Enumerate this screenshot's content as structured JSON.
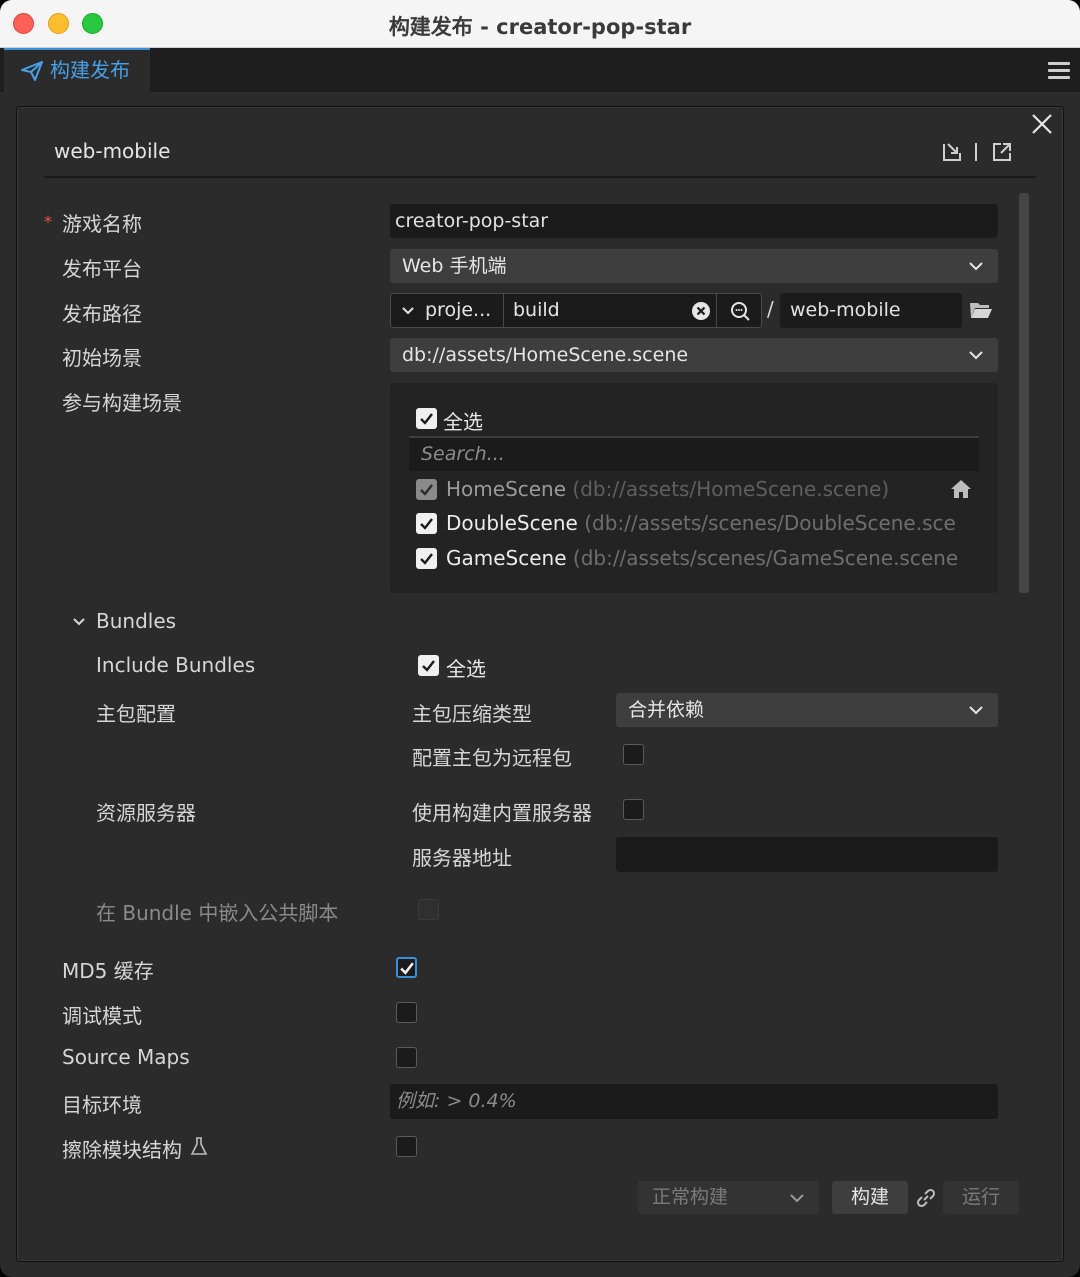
{
  "window": {
    "title": "构建发布 - creator-pop-star"
  },
  "tab": {
    "label": "构建发布"
  },
  "panel": {
    "platform_id": "web-mobile"
  },
  "form": {
    "game_name_label": "游戏名称",
    "game_name_required": "*",
    "game_name_value": "creator-pop-star",
    "platform_label": "发布平台",
    "platform_value": "Web 手机端",
    "path_label": "发布路径",
    "path_project": "proje...",
    "path_dir": "build",
    "path_separator": "/",
    "path_subdir": "web-mobile",
    "start_scene_label": "初始场景",
    "start_scene_value": "db://assets/HomeScene.scene",
    "scenes_label": "参与构建场景",
    "scenes_select_all": "全选",
    "scenes_search_placeholder": "Search...",
    "scenes": [
      {
        "name": "HomeScene",
        "path": "(db://assets/HomeScene.scene)",
        "checked": true,
        "locked": true
      },
      {
        "name": "DoubleScene",
        "path": "(db://assets/scenes/DoubleScene.sce",
        "checked": true,
        "locked": false
      },
      {
        "name": "GameScene",
        "path": "(db://assets/scenes/GameScene.scene",
        "checked": true,
        "locked": false
      }
    ]
  },
  "bundles": {
    "section_label": "Bundles",
    "include_label": "Include Bundles",
    "include_select_all": "全选",
    "main_config_label": "主包配置",
    "compress_type_label": "主包压缩类型",
    "compress_type_value": "合并依赖",
    "remote_label": "配置主包为远程包",
    "asset_server_label": "资源服务器",
    "builtin_server_label": "使用构建内置服务器",
    "server_address_label": "服务器地址",
    "server_address_value": "",
    "embed_script_label": "在 Bundle 中嵌入公共脚本"
  },
  "options": {
    "md5_label": "MD5 缓存",
    "md5_checked": true,
    "debug_label": "调试模式",
    "debug_checked": false,
    "source_maps_label": "Source Maps",
    "source_maps_checked": false,
    "target_env_label": "目标环境",
    "target_env_placeholder": "例如: > 0.4%",
    "erase_modules_label": "擦除模块结构",
    "erase_modules_checked": false
  },
  "footer": {
    "build_mode": "正常构建",
    "build_button": "构建",
    "run_button": "运行"
  },
  "colors": {
    "accent": "#3a8fd6",
    "panel_bg": "#2b2b2b",
    "field_bg": "#1b1b1b",
    "select_bg": "#3e3e3e",
    "required": "#e8543e"
  }
}
